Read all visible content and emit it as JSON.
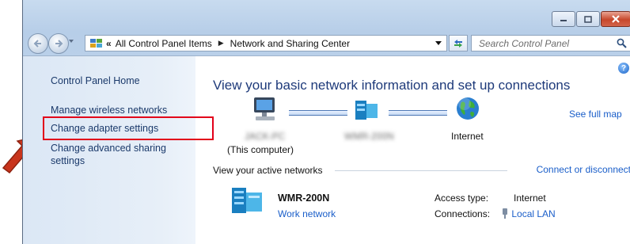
{
  "window": {
    "caption_buttons": [
      "minimize-icon",
      "maximize-icon",
      "close-icon"
    ]
  },
  "address_bar": {
    "prefix": "«",
    "crumbs": [
      "All Control Panel Items",
      "Network and Sharing Center"
    ],
    "search_placeholder": "Search Control Panel"
  },
  "sidebar": {
    "items": [
      "Control Panel Home",
      "Manage wireless networks",
      "Change adapter settings",
      "Change advanced sharing",
      "settings"
    ],
    "highlighted_item": "Change adapter settings",
    "highlight_color": "#e2001a"
  },
  "main": {
    "help": "?",
    "heading": "View your basic network information and set up connections",
    "see_full_map": "See full map",
    "map": {
      "computer_label": "(This computer)",
      "internet_label": "Internet"
    },
    "active_networks_title": "View your active networks",
    "connect_link": "Connect or disconnect",
    "network": {
      "name": "WMR-200N",
      "type": "Work network",
      "access_label": "Access type:",
      "access_value": "Internet",
      "connections_label": "Connections:",
      "connections_value": "Local LAN"
    }
  },
  "colors": {
    "link": "#1a5ec9",
    "heading": "#1e3a7a",
    "sidebar_link": "#1b3a6b"
  }
}
